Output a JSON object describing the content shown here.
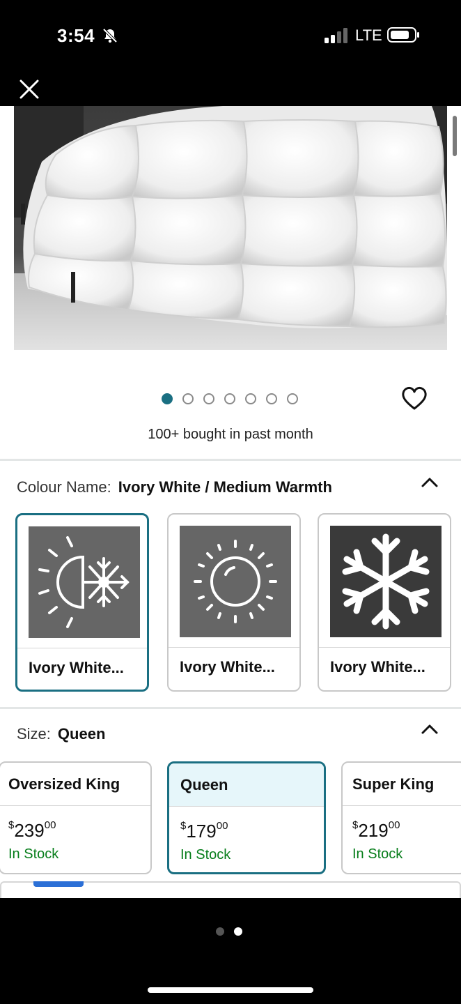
{
  "status_bar": {
    "time": "3:54",
    "carrier": "LTE",
    "signal_bars_filled": 2,
    "signal_bars_total": 4
  },
  "product": {
    "image_dots_total": 7,
    "image_dot_active": 1,
    "bought_text": "100+ bought in past month"
  },
  "colour": {
    "label": "Colour Name:",
    "value": "Ivory White / Medium Warmth",
    "options": [
      {
        "label": "Ivory White...",
        "icon": "half-sun-snowflake-icon",
        "selected": true
      },
      {
        "label": "Ivory White...",
        "icon": "sun-icon",
        "selected": false
      },
      {
        "label": "Ivory White...",
        "icon": "snowflake-icon",
        "selected": false
      }
    ]
  },
  "size": {
    "label": "Size:",
    "value": "Queen",
    "options": [
      {
        "name": "Oversized King",
        "price_whole": "239",
        "price_fraction": "00",
        "currency": "$",
        "stock": "In Stock",
        "selected": false
      },
      {
        "name": "Queen",
        "price_whole": "179",
        "price_fraction": "00",
        "currency": "$",
        "stock": "In Stock",
        "selected": true
      },
      {
        "name": "Super King",
        "price_whole": "219",
        "price_fraction": "00",
        "currency": "$",
        "stock": "In Stock",
        "selected": false
      }
    ]
  },
  "pager": {
    "total": 2,
    "active": 2
  },
  "colors": {
    "accent": "#1a6f82",
    "in_stock": "#067d1a",
    "selected_bg": "#e6f6fa"
  }
}
